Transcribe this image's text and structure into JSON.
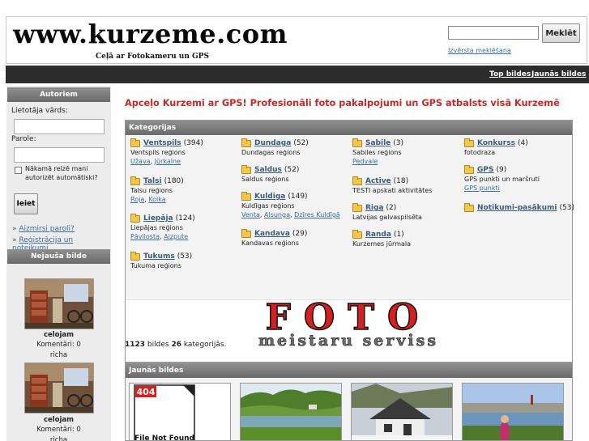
{
  "header": {
    "logo_title": "www.kurzeme.com",
    "logo_subtitle": "Ceļā ar Fotokameru un GPS",
    "search_placeholder": "",
    "search_button": "Meklēt",
    "advanced_search": "Izvērsta meklēšana"
  },
  "nav": {
    "top_pictures": "Top bildes",
    "new_pictures": "Jaunās bildes"
  },
  "sidebar": {
    "login_title": "Autoriem",
    "username_label": "Lietotāja vārds:",
    "password_label": "Parole:",
    "remember_label": "Nākamā reizē mani autorizēt automātiski?",
    "login_button": "Ieiet",
    "forgot_password": "Aizmirsi paroli?",
    "register": "Reģistrācija un noteikumi",
    "random_title": "Nejauša bilde",
    "random_items": [
      {
        "user": "celojam",
        "comments": "Komentāri: 0",
        "extra": "richa"
      },
      {
        "user": "celojam",
        "comments": "Komentāri: 0",
        "extra": "richa"
      }
    ]
  },
  "main": {
    "headline": "Apceļo Kurzemi ar GPS! Profesionāli foto pakalpojumi un GPS atbalsts visā Kurzemē",
    "categories_title": "Kategorijas",
    "categories": [
      {
        "name": "Ventspils",
        "count": "(394)",
        "desc": "Ventspils reģions",
        "subs": [
          "Užava",
          "Jūrkalne"
        ]
      },
      {
        "name": "Talsi",
        "count": "(180)",
        "desc": "Talsu reģions",
        "subs": [
          "Roja",
          "Kolka"
        ]
      },
      {
        "name": "Liepāja",
        "count": "(124)",
        "desc": "Liepājas reģions",
        "subs": [
          "Pāvilosta",
          "Aizpute"
        ]
      },
      {
        "name": "Tukums",
        "count": "(53)",
        "desc": "Tukuma reģions",
        "subs": []
      },
      {
        "name": "Dundaga",
        "count": "(52)",
        "desc": "Dundagas reģions",
        "subs": []
      },
      {
        "name": "Saldus",
        "count": "(52)",
        "desc": "Saldus reģions",
        "subs": []
      },
      {
        "name": "Kuldiga",
        "count": "(149)",
        "desc": "Kuldīgas reģions",
        "subs": [
          "Venta",
          "Alsunga",
          "Dzīres Kuldīgā"
        ]
      },
      {
        "name": "Kandava",
        "count": "(29)",
        "desc": "Kandavas reģions",
        "subs": []
      },
      {
        "name": "Sabile",
        "count": "(3)",
        "desc": "Sabiles reģions",
        "subs": [
          "Pedvale"
        ]
      },
      {
        "name": "Active",
        "count": "(18)",
        "desc": "TESTI apskati aktivitātes",
        "subs": []
      },
      {
        "name": "Riga",
        "count": "(2)",
        "desc": "Latvijas galvaspilsēta",
        "subs": []
      },
      {
        "name": "Randa",
        "count": "(1)",
        "desc": "Kurzemes jūrmala",
        "subs": []
      },
      {
        "name": "Konkurss",
        "count": "(4)",
        "desc": "fotodraza",
        "subs": []
      },
      {
        "name": "GPS",
        "count": "(9)",
        "desc": "GPS punkti un maršruti",
        "subs": [
          "GPS punkti"
        ]
      },
      {
        "name": "Notikumi-pasākumi",
        "count": "(53)",
        "desc": "",
        "subs": []
      }
    ],
    "banner_line1": "FOTO",
    "banner_line2": "meistaru serviss",
    "count_pictures": "1123",
    "count_mid": " bildes ",
    "count_categories": "26",
    "count_end": " kategorijās.",
    "new_pictures_title": "Jaunās bildes",
    "file_not_found_code": "404",
    "file_not_found_text": "File Not Found"
  },
  "colors": {
    "headline": "#c62828",
    "link": "#3c6e9c",
    "navbar": "#2c2c2c"
  }
}
